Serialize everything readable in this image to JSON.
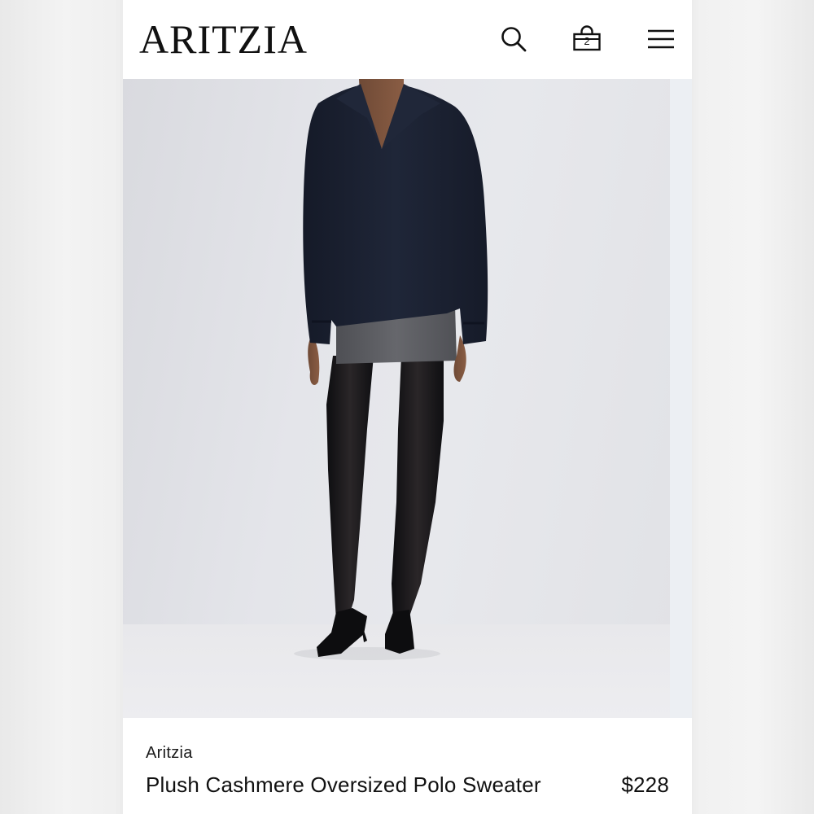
{
  "header": {
    "logo_text": "ARITZIA",
    "search_icon": "search-icon",
    "bag_icon": "shopping-bag-icon",
    "bag_count": "2",
    "menu_icon": "hamburger-menu-icon"
  },
  "product": {
    "brand": "Aritzia",
    "name": "Plush Cashmere Oversized Polo Sweater",
    "price": "$228",
    "colors": {
      "sweater": "#1c2233",
      "skirt": "#5a5b5f",
      "tights": "#141416",
      "shoes": "#0d0d0f"
    }
  }
}
